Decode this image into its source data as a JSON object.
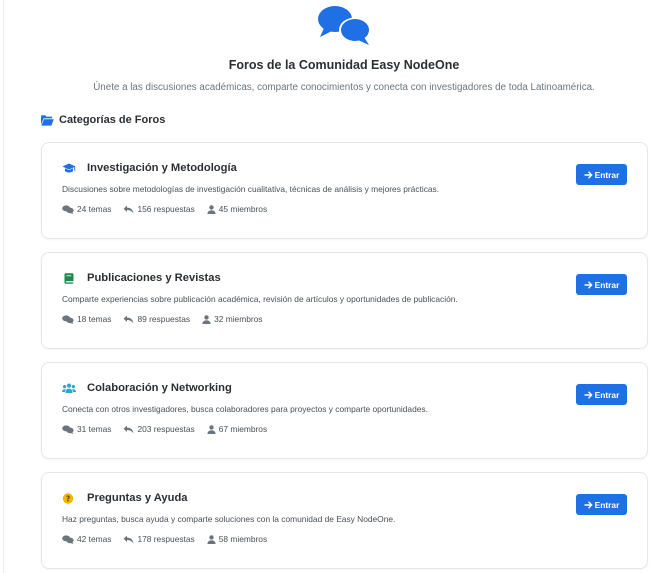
{
  "header": {
    "title": "Foros de la Comunidad Easy NodeOne",
    "subtitle": "Únete a las discusiones académicas, comparte conocimientos y conecta con investigadores de toda Latinoamérica."
  },
  "section": {
    "heading": "Categorías de Foros"
  },
  "colors": {
    "accent": "#1f6fe5",
    "graduation_icon": "#1f6fe5",
    "book_icon": "#1e8a4c",
    "users_icon": "#2aa9c9",
    "question_icon": "#f5b400"
  },
  "categories": [
    {
      "icon": "graduation-cap-icon",
      "title": "Investigación y Metodología",
      "description": "Discusiones sobre metodologías de investigación cualitativa, técnicas de análisis y mejores prácticas.",
      "topics": "24 temas",
      "replies": "156 respuestas",
      "members": "45 miembros",
      "button_label": "Entrar"
    },
    {
      "icon": "book-icon",
      "title": "Publicaciones y Revistas",
      "description": "Comparte experiencias sobre publicación académica, revisión de artículos y oportunidades de publicación.",
      "topics": "18 temas",
      "replies": "89 respuestas",
      "members": "32 miembros",
      "button_label": "Entrar"
    },
    {
      "icon": "users-icon",
      "title": "Colaboración y Networking",
      "description": "Conecta con otros investigadores, busca colaboradores para proyectos y comparte oportunidades.",
      "topics": "31 temas",
      "replies": "203 respuestas",
      "members": "67 miembros",
      "button_label": "Entrar"
    },
    {
      "icon": "question-circle-icon",
      "title": "Preguntas y Ayuda",
      "description": "Haz preguntas, busca ayuda y comparte soluciones con la comunidad de Easy NodeOne.",
      "topics": "42 temas",
      "replies": "178 respuestas",
      "members": "58 miembros",
      "button_label": "Entrar"
    }
  ]
}
